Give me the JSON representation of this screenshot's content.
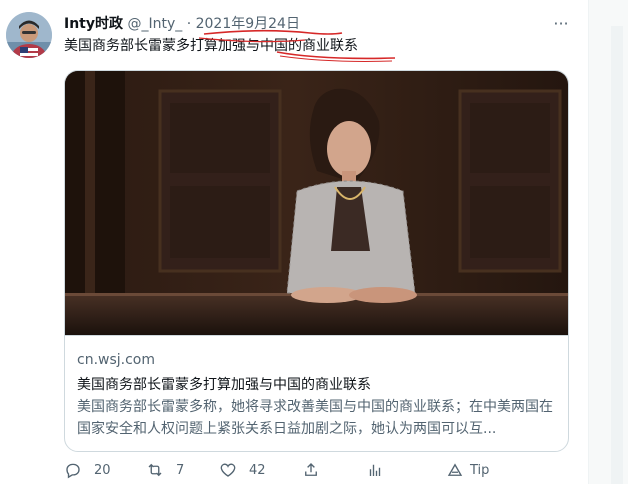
{
  "tweet": {
    "author_name": "Inty时政",
    "handle": "@_Inty_",
    "separator": "·",
    "date": "2021年9月24日",
    "more": "···",
    "text": "美国商务部长雷蒙多打算加强与中国的商业联系"
  },
  "card": {
    "domain": "cn.wsj.com",
    "title": "美国商务部长雷蒙多打算加强与中国的商业联系",
    "description": "美国商务部长雷蒙多称，她将寻求改善美国与中国的商业联系；在中美两国在国家安全和人权问题上紧张关系日益加剧之际，她认为两国可以互..."
  },
  "actions": {
    "reply_count": "20",
    "retweet_count": "7",
    "like_count": "42",
    "tip_label": "Tip"
  },
  "colors": {
    "secondary_text": "#536471",
    "annotation_red": "#d62828",
    "border": "#cfd9de"
  }
}
